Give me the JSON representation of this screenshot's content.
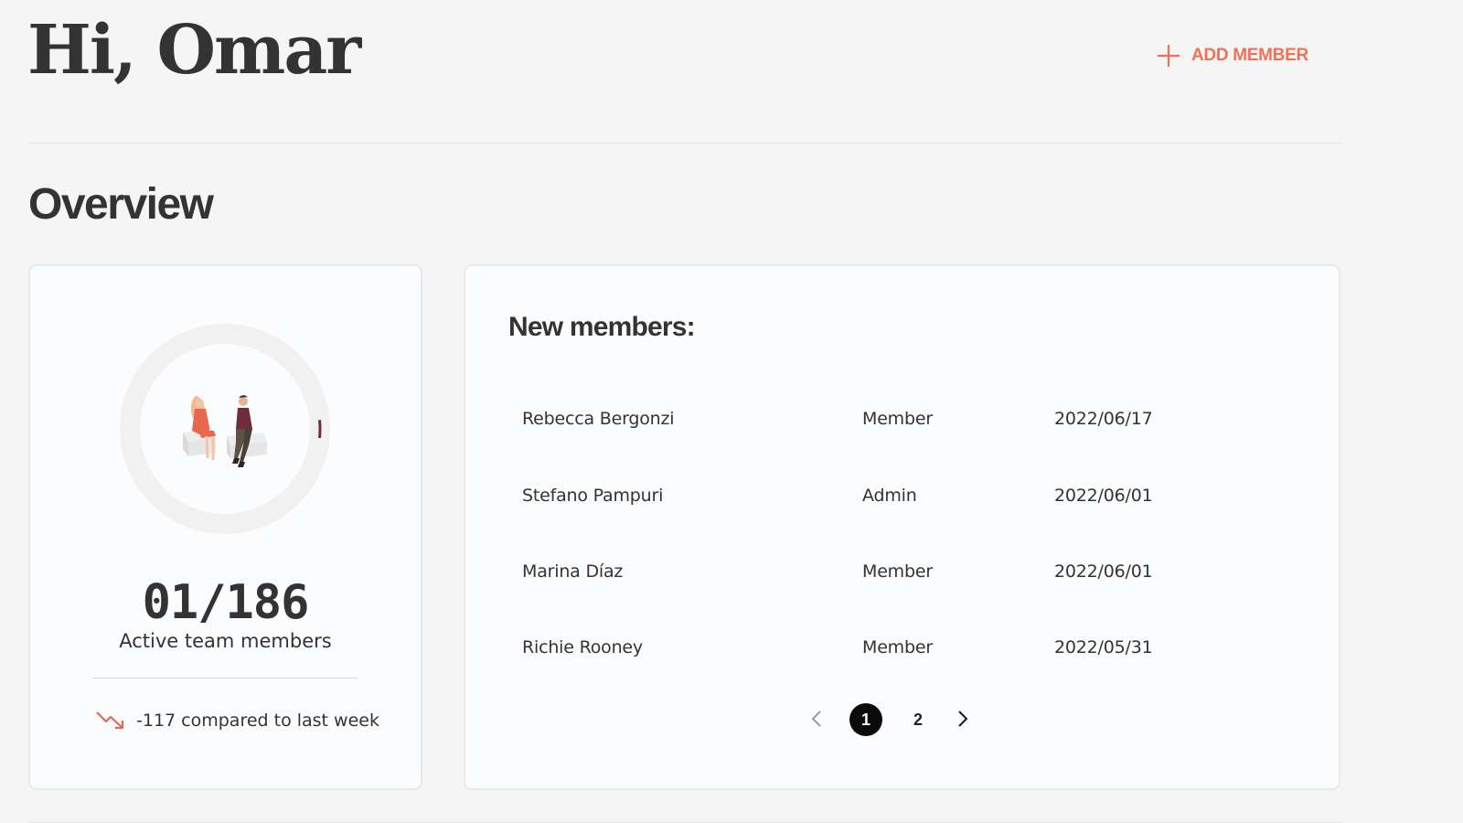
{
  "header": {
    "greeting": "Hi, Omar",
    "add_member_label": "ADD MEMBER",
    "add_member_icon": "plus-icon"
  },
  "overview": {
    "title": "Overview",
    "active_card": {
      "active_count": "01/186",
      "label": "Active team members",
      "active": 1,
      "total": 186,
      "progress_fraction": 0.0054,
      "illustration": "team-illustration",
      "trend_icon": "trending-down-icon",
      "trend_text": "-117 compared to last week"
    },
    "new_members": {
      "title": "New members:",
      "rows": [
        {
          "name": "Rebecca Bergonzi",
          "role": "Member",
          "date": "2022/06/17"
        },
        {
          "name": "Stefano Pampuri",
          "role": "Admin",
          "date": "2022/06/01"
        },
        {
          "name": "Marina Díaz",
          "role": "Member",
          "date": "2022/06/01"
        },
        {
          "name": "Richie Rooney",
          "role": "Member",
          "date": "2022/05/31"
        }
      ],
      "pagination": {
        "pages": [
          "1",
          "2"
        ],
        "current": "1",
        "prev_icon": "chevron-left-icon",
        "next_icon": "chevron-right-icon"
      }
    }
  },
  "colors": {
    "background": "#f5f5f5",
    "card_background": "#fbfcfd",
    "accent": "#f07156",
    "text": "#333333",
    "progress": "#6e2c3c",
    "ring_track": "#f1f1f1",
    "active_page": "#0b0b0b"
  }
}
